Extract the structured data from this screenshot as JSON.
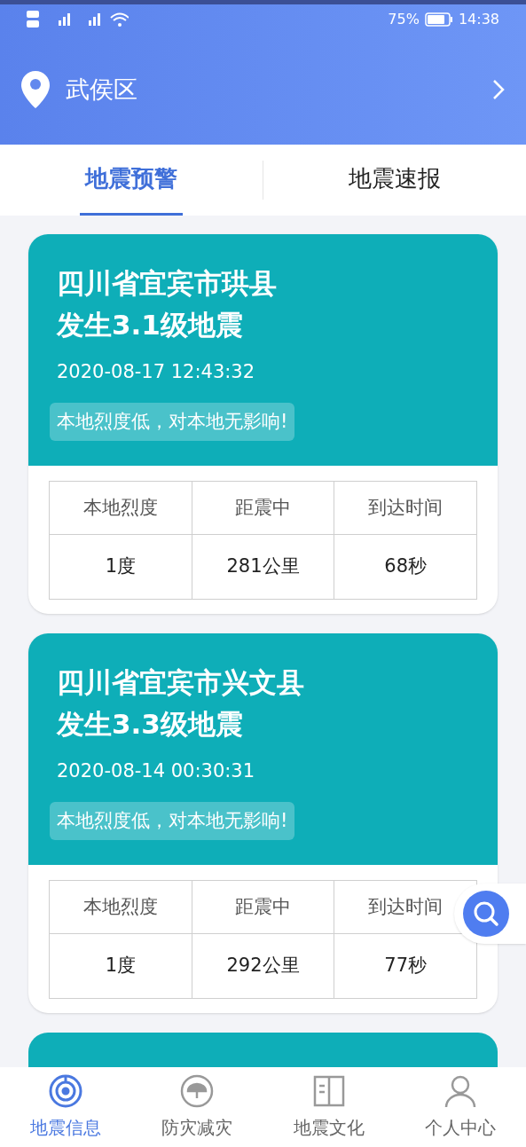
{
  "status_bar": {
    "battery": "75%",
    "time": "14:38"
  },
  "location": {
    "name": "武侯区"
  },
  "tabs": [
    {
      "label": "地震预警",
      "selected": true
    },
    {
      "label": "地震速报",
      "selected": false
    }
  ],
  "alerts": [
    {
      "title_lines": [
        "四川省宜宾市珙县",
        "发生3.1级地震"
      ],
      "time": "2020-08-17 12:43:32",
      "notice": "本地烈度低，对本地无影响!",
      "columns": [
        "本地烈度",
        "距震中",
        "到达时间"
      ],
      "values": [
        "1度",
        "281公里",
        "68秒"
      ]
    },
    {
      "title_lines": [
        "四川省宜宾市兴文县",
        "发生3.3级地震"
      ],
      "time": "2020-08-14 00:30:31",
      "notice": "本地烈度低，对本地无影响!",
      "columns": [
        "本地烈度",
        "距震中",
        "到达时间"
      ],
      "values": [
        "1度",
        "292公里",
        "77秒"
      ]
    }
  ],
  "bottom_nav": [
    {
      "label": "地震信息",
      "selected": true
    },
    {
      "label": "防灾减灾",
      "selected": false
    },
    {
      "label": "地震文化",
      "selected": false
    },
    {
      "label": "个人中心",
      "selected": false
    }
  ]
}
